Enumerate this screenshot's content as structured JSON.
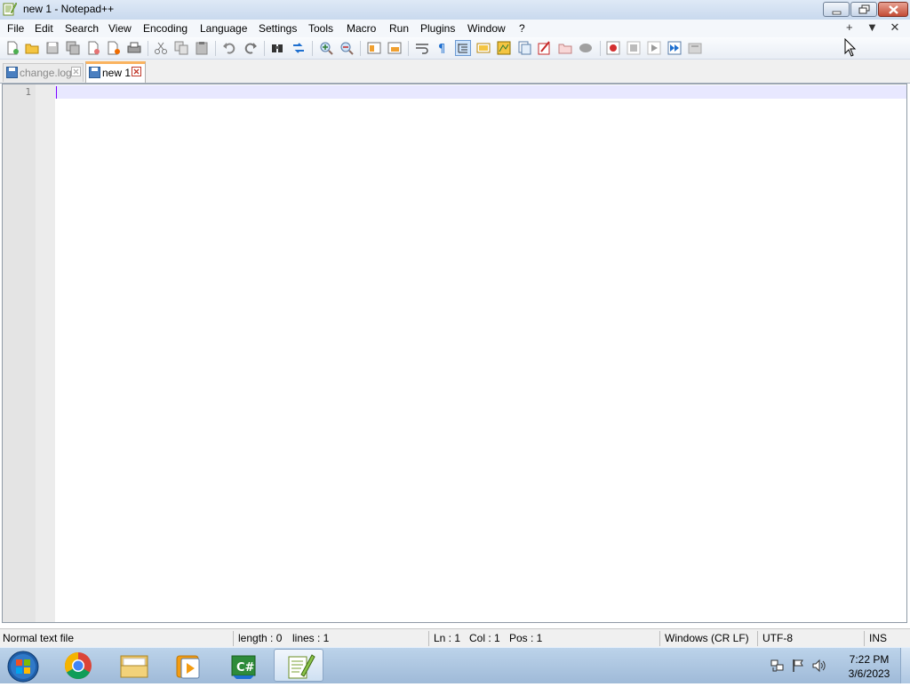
{
  "window": {
    "title": "new 1 - Notepad++"
  },
  "menu": {
    "items": [
      "File",
      "Edit",
      "Search",
      "View",
      "Encoding",
      "Language",
      "Settings",
      "Tools",
      "Macro",
      "Run",
      "Plugins",
      "Window",
      "?"
    ],
    "right_controls": [
      "+",
      "▼",
      "✕"
    ]
  },
  "tabs": [
    {
      "label": "change.log",
      "active": false
    },
    {
      "label": "new 1",
      "active": true
    }
  ],
  "editor": {
    "line_numbers": [
      "1"
    ],
    "content": ""
  },
  "status": {
    "file_type": "Normal text file",
    "length": "length : 0",
    "lines": "lines : 1",
    "ln": "Ln : 1",
    "col": "Col : 1",
    "pos": "Pos : 1",
    "eol": "Windows (CR LF)",
    "encoding": "UTF-8",
    "mode": "INS"
  },
  "taskbar": {
    "time": "7:22 PM",
    "date": "3/6/2023",
    "apps": [
      "start-orb",
      "chrome",
      "file-explorer",
      "media-player",
      "csharp-app",
      "notepad-plus-plus"
    ]
  },
  "colors": {
    "current_line": "#e8e8ff",
    "caret": "#8000ff",
    "active_tab_accent": "#fab35f"
  }
}
